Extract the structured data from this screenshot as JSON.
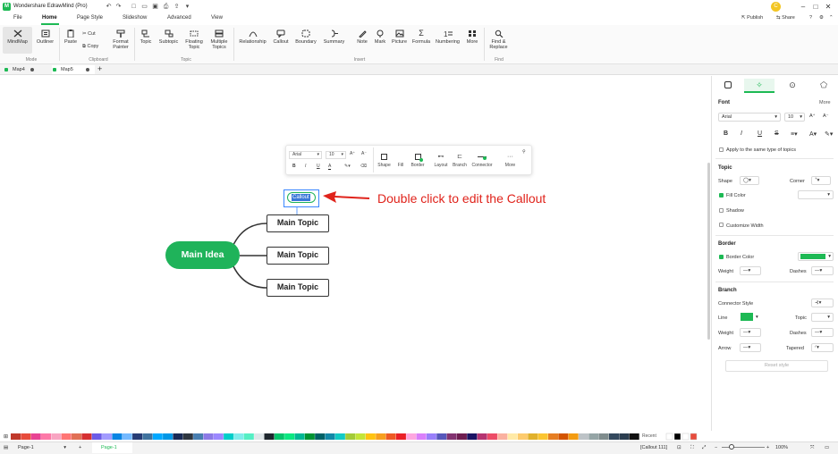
{
  "app": {
    "title": "Wondershare EdrawMind (Pro)"
  },
  "title_actions": {
    "publish": "Publish",
    "share": "Share",
    "avatar": "C"
  },
  "menu": [
    "File",
    "Home",
    "Page Style",
    "Slideshow",
    "Advanced",
    "View"
  ],
  "ribbon": {
    "mode": {
      "mindmap": "MindMap",
      "outliner": "Outliner",
      "group": "Mode"
    },
    "clipboard": {
      "paste": "Paste",
      "cut": "Cut",
      "copy": "Copy",
      "format_painter": "Format Painter",
      "group": "Clipboard"
    },
    "topic": {
      "topic": "Topic",
      "subtopic": "Subtopic",
      "floating": "Floating Topic",
      "multiple": "Multiple Topics",
      "group": "Topic"
    },
    "insert": {
      "relationship": "Relationship",
      "callout": "Callout",
      "boundary": "Boundary",
      "summary": "Summary",
      "note": "Note",
      "mark": "Mark",
      "picture": "Picture",
      "formula": "Formula",
      "numbering": "Numbering",
      "more": "More",
      "group": "Insert"
    },
    "find": {
      "find_replace": "Find & Replace",
      "group": "Find"
    }
  },
  "tabs": [
    {
      "label": "Map4"
    },
    {
      "label": "Map5"
    }
  ],
  "float_toolbar": {
    "font": "Arial",
    "size": "10",
    "bold": "B",
    "italic": "I",
    "underline": "U",
    "font_color": "A",
    "shape": "Shape",
    "fill": "Fill",
    "border": "Border",
    "layout": "Layout",
    "branch": "Branch",
    "connector": "Connector",
    "more": "More"
  },
  "mindmap": {
    "main_idea": "Main Idea",
    "topics": [
      "Main Topic",
      "Main Topic",
      "Main Topic"
    ],
    "callout": "Callout"
  },
  "annotation": "Double click to edit the Callout",
  "panel": {
    "font_section": "Font",
    "more": "More",
    "font_name": "Arial",
    "font_size": "10",
    "apply_same": "Apply to the same type of topics",
    "topic_section": "Topic",
    "shape": "Shape",
    "corner": "Corner",
    "fill_color": "Fill Color",
    "shadow": "Shadow",
    "customize_width": "Customize Width",
    "border_section": "Border",
    "border_color": "Border Color",
    "weight": "Weight",
    "dashes": "Dashes",
    "branch_section": "Branch",
    "connector_style": "Connector Style",
    "line": "Line",
    "topic": "Topic",
    "weight2": "Weight",
    "dashes2": "Dashes",
    "arrow": "Arrow",
    "tapered": "Tapered",
    "reset": "Reset style"
  },
  "colors": {
    "accent": "#1db954",
    "node_green": "#1fb35a",
    "annotation_red": "#e0231b",
    "selection_blue": "#3a86ff"
  },
  "palette": {
    "recent": "Recent"
  },
  "status": {
    "page_select": "Page-1",
    "page_tab": "Page-1",
    "callout_info": "[Callout 111]",
    "zoom": "100%"
  }
}
